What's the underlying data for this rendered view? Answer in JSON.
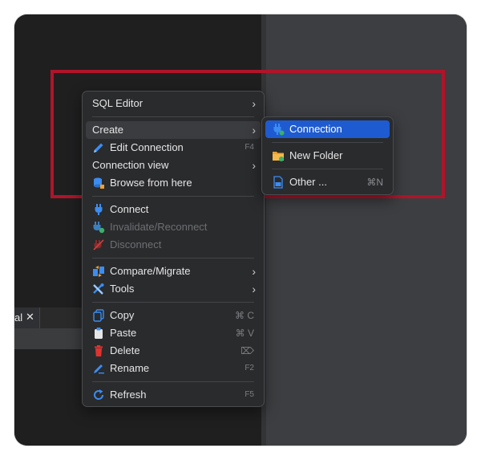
{
  "tab": {
    "partial_label": "al",
    "close_glyph": "✕"
  },
  "context_menu": {
    "items": [
      {
        "key": "sql-editor",
        "label": "SQL Editor",
        "has_submenu": true,
        "icon": null
      },
      {
        "key": "create",
        "label": "Create",
        "has_submenu": true,
        "icon": null,
        "active": true
      },
      {
        "key": "edit-connection",
        "label": "Edit Connection",
        "icon": "pencil-icon",
        "shortcut": "F4"
      },
      {
        "key": "connection-view",
        "label": "Connection view",
        "has_submenu": true,
        "icon": null
      },
      {
        "key": "browse-from-here",
        "label": "Browse from here",
        "icon": "database-icon"
      },
      {
        "key": "connect",
        "label": "Connect",
        "icon": "plug-icon"
      },
      {
        "key": "invalidate-reconnect",
        "label": "Invalidate/Reconnect",
        "icon": "reconnect-icon",
        "disabled": true
      },
      {
        "key": "disconnect",
        "label": "Disconnect",
        "icon": "disconnect-icon",
        "disabled": true
      },
      {
        "key": "compare-migrate",
        "label": "Compare/Migrate",
        "has_submenu": true,
        "icon": "compare-icon"
      },
      {
        "key": "tools",
        "label": "Tools",
        "has_submenu": true,
        "icon": "tools-icon"
      },
      {
        "key": "copy",
        "label": "Copy",
        "icon": "copy-icon",
        "shortcut": "⌘ C"
      },
      {
        "key": "paste",
        "label": "Paste",
        "icon": "paste-icon",
        "shortcut": "⌘ V"
      },
      {
        "key": "delete",
        "label": "Delete",
        "icon": "delete-icon",
        "shortcut": "⌦"
      },
      {
        "key": "rename",
        "label": "Rename",
        "icon": "rename-icon",
        "shortcut": "F2"
      },
      {
        "key": "refresh",
        "label": "Refresh",
        "icon": "refresh-icon",
        "shortcut": "F5"
      }
    ],
    "submenu_arrow": "›"
  },
  "create_submenu": {
    "items": [
      {
        "key": "connection",
        "label": "Connection",
        "icon": "new-connection-icon",
        "active": true
      },
      {
        "key": "new-folder",
        "label": "New Folder",
        "icon": "new-folder-icon"
      },
      {
        "key": "other",
        "label": "Other ...",
        "icon": "other-object-icon",
        "shortcut": "⌘N"
      }
    ]
  },
  "colors": {
    "highlight_border": "#b0142a",
    "menu_bg": "#2a2b2d",
    "selection_blue": "#1f5bd0",
    "icon_blue": "#3b8df2",
    "icon_red": "#e0332f",
    "icon_orange": "#f0a030"
  }
}
